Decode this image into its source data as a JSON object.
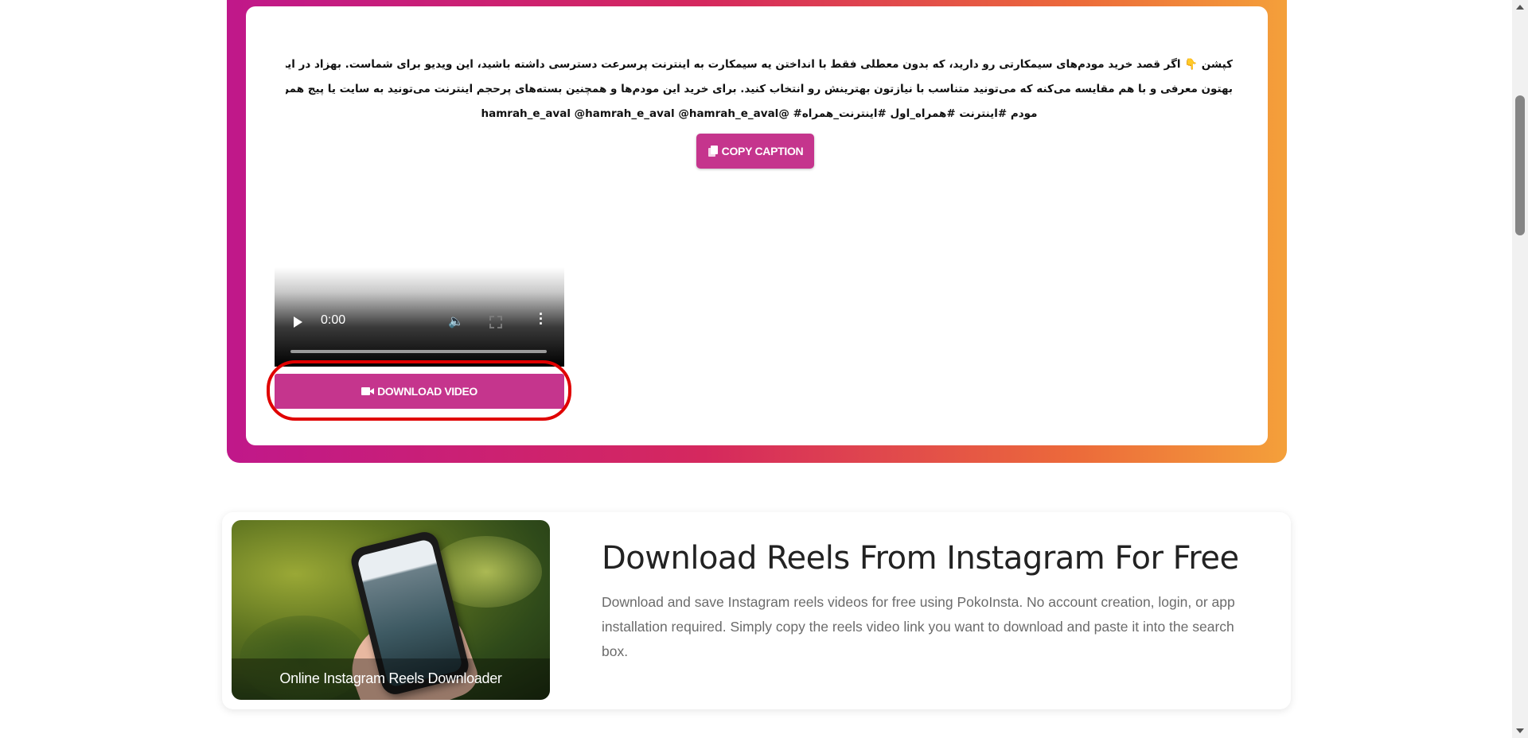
{
  "result": {
    "caption_lines": [
      "کپشن 👇 اگر قصد خرید مودم‌های سیمکارتی رو دارید، که بدون معطلی فقط با انداختن یه سیمکارت به اینترنت پرسرعت دسترسی داشته باشید، این ویدیو برای شماست. بهزاد در این ویدیو چند مودم مختلف رو",
      "بهتون معرفی و با هم مقایسه می‌کنه که می‌تونید متناسب با نیازتون بهترینش رو انتخاب کنید.  برای خرید این مودم‌ها و همچنین بسته‌های پرحجم اینترنت می‌تونید به سایت یا پیج همراه اول سر بزنید.",
      "مودم #اینترنت #همراه_اول #اینترنت_همراه#   @hamrah_e_aval @hamrah_e_aval @hamrah_e_aval"
    ],
    "copy_caption_label": "COPY CAPTION",
    "video": {
      "time": "0:00"
    },
    "download_video_label": "DOWNLOAD VIDEO"
  },
  "feature": {
    "image_caption": "Online Instagram Reels Downloader",
    "title": "Download Reels From Instagram For Free",
    "description": "Download and save Instagram reels videos for free using PokoInsta. No account creation, login, or app installation required. Simply copy the reels video link you want to download and paste it into the search box."
  },
  "colors": {
    "accent": "#c5358d",
    "highlight_ring": "#e00000",
    "gradient_start": "#c0188a",
    "gradient_end": "#f4a03a"
  },
  "icons": {
    "copy": "copy-icon",
    "download": "video-camera-icon",
    "play": "play-icon",
    "volume": "volume-icon",
    "fullscreen": "fullscreen-icon",
    "more": "more-vertical-icon"
  }
}
